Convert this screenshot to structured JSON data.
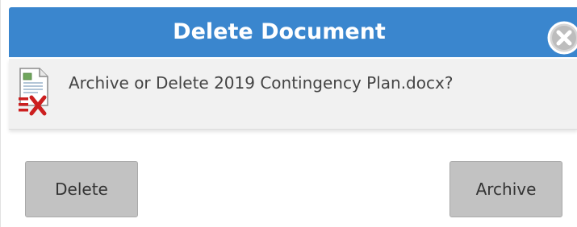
{
  "dialog": {
    "title": "Delete Document",
    "message": "Archive or Delete 2019 Contingency Plan.docx?",
    "close_icon": "close-circle-x-icon",
    "document_icon": "document-delete-icon"
  },
  "buttons": {
    "delete_label": "Delete",
    "archive_label": "Archive"
  },
  "colors": {
    "titlebar": "#3a86ce",
    "button": "#c2c2c2",
    "message_band": "#f1f1f1",
    "delete_mark": "#cc1f1f"
  }
}
